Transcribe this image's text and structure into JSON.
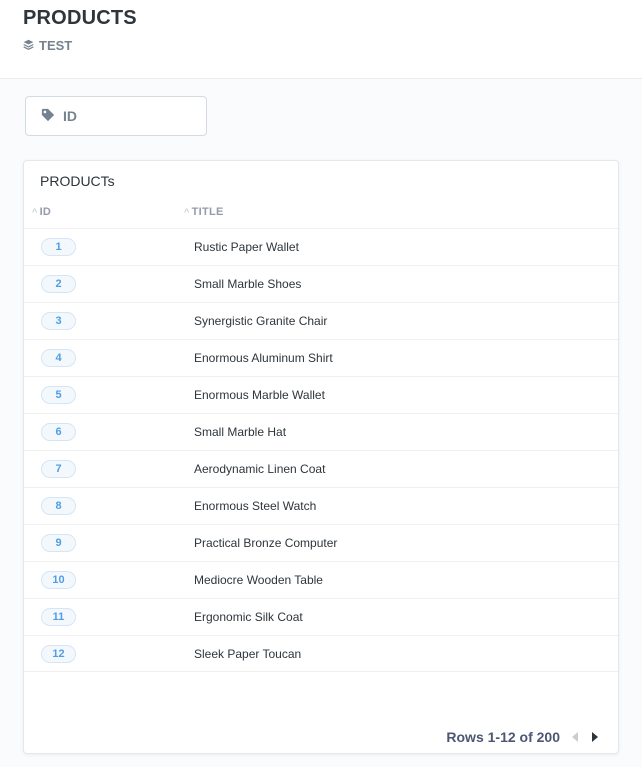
{
  "header": {
    "title": "PRODUCTS",
    "collection": "TEST"
  },
  "filter": {
    "label": "ID"
  },
  "table": {
    "title": "PRODUCTs",
    "columns": [
      "ID",
      "TITLE"
    ],
    "rows": [
      {
        "id": "1",
        "title": "Rustic Paper Wallet"
      },
      {
        "id": "2",
        "title": "Small Marble Shoes"
      },
      {
        "id": "3",
        "title": "Synergistic Granite Chair"
      },
      {
        "id": "4",
        "title": "Enormous Aluminum Shirt"
      },
      {
        "id": "5",
        "title": "Enormous Marble Wallet"
      },
      {
        "id": "6",
        "title": "Small Marble Hat"
      },
      {
        "id": "7",
        "title": "Aerodynamic Linen Coat"
      },
      {
        "id": "8",
        "title": "Enormous Steel Watch"
      },
      {
        "id": "9",
        "title": "Practical Bronze Computer"
      },
      {
        "id": "10",
        "title": "Mediocre Wooden Table"
      },
      {
        "id": "11",
        "title": "Ergonomic Silk Coat"
      },
      {
        "id": "12",
        "title": "Sleek Paper Toucan"
      }
    ]
  },
  "pagination": {
    "text": "Rows 1-12 of 200"
  },
  "icons": {
    "collection": "layers-icon",
    "filter": "tag-icon",
    "prev": "triangle-left-icon",
    "next": "triangle-right-icon"
  },
  "colors": {
    "brand": "#509ee3",
    "text": "#2e353b",
    "muted": "#74838f"
  }
}
